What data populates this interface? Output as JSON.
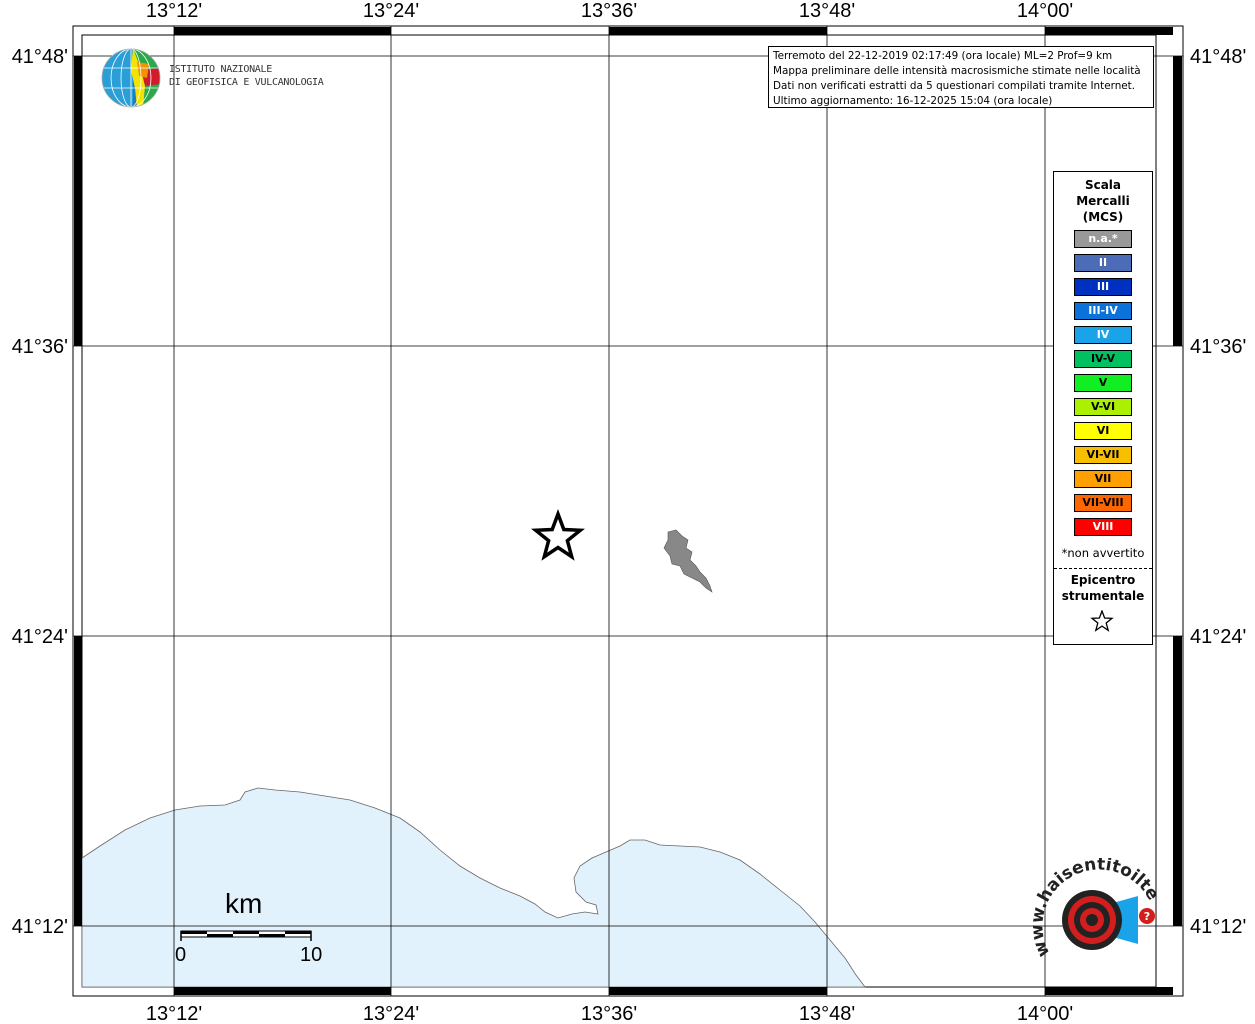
{
  "map": {
    "lon_labels": [
      "13°12'",
      "13°24'",
      "13°36'",
      "13°48'",
      "14°00'"
    ],
    "lat_labels": [
      "41°48'",
      "41°36'",
      "41°24'",
      "41°12'"
    ]
  },
  "organization": {
    "line1": "ISTITUTO NAZIONALE",
    "line2": "DI GEOFISICA E VULCANOLOGIA"
  },
  "info": {
    "line1": "Terremoto del 22-12-2019 02:17:49 (ora locale) ML=2 Prof=9 km",
    "line2": "Mappa preliminare delle intensità macrosismiche stimate nelle località",
    "line3": "Dati non verificati estratti da 5 questionari compilati tramite Internet.",
    "line4": "Ultimo aggiornamento: 16-12-2025 15:04 (ora locale)"
  },
  "legend": {
    "title_line1": "Scala",
    "title_line2": "Mercalli",
    "title_line3": "(MCS)",
    "items": [
      {
        "label": "n.a.*",
        "color": "#999999"
      },
      {
        "label": "II",
        "color": "#4d6cb7"
      },
      {
        "label": "III",
        "color": "#0030c0"
      },
      {
        "label": "III-IV",
        "color": "#0a72d8"
      },
      {
        "label": "IV",
        "color": "#1aa3e8"
      },
      {
        "label": "IV-V",
        "color": "#00c060"
      },
      {
        "label": "V",
        "color": "#11ef22"
      },
      {
        "label": "V-VI",
        "color": "#aaf000"
      },
      {
        "label": "VI",
        "color": "#ffff00"
      },
      {
        "label": "VI-VII",
        "color": "#f8be00"
      },
      {
        "label": "VII",
        "color": "#ffa000"
      },
      {
        "label": "VII-VIII",
        "color": "#ff6600"
      },
      {
        "label": "VIII",
        "color": "#ff0000"
      }
    ],
    "na_note": "*non avvertito",
    "epicenter_line1": "Epicentro",
    "epicenter_line2": "strumentale"
  },
  "scale_bar": {
    "unit": "km",
    "start": "0",
    "end": "10"
  },
  "site_logo": {
    "text": "www.haisentitoilterremoto.it"
  },
  "colors": {
    "sea": "#e2f2fc",
    "lake": "#888888"
  }
}
